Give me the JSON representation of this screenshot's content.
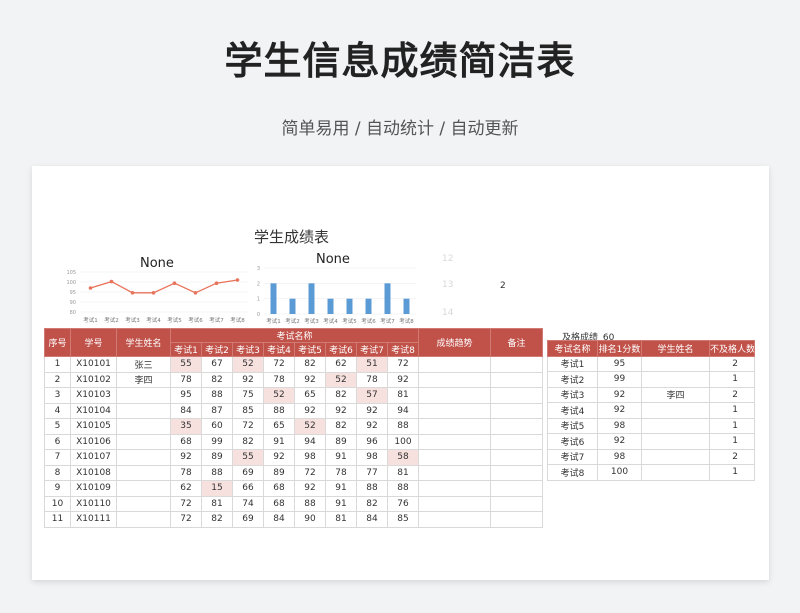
{
  "header": {
    "title": "学生信息成绩简洁表",
    "subtitle": "简单易用 / 自动统计 / 自动更新"
  },
  "sheet": {
    "title": "学生成绩表",
    "chart_label_value": "2",
    "pass_label": "及格成绩",
    "pass_value": "60",
    "faint_row_numbers": [
      "12",
      "13",
      "14"
    ]
  },
  "chart_data": [
    {
      "type": "line",
      "title": "None",
      "categories": [
        "考试1",
        "考试2",
        "考试3",
        "考试4",
        "考试5",
        "考试6",
        "考试7",
        "考试8"
      ],
      "values": [
        95,
        99,
        92,
        92,
        98,
        92,
        98,
        100
      ],
      "ylim": [
        80,
        105
      ],
      "yticks": [
        "80",
        "90",
        "95",
        "100",
        "105"
      ],
      "color": "#e8735a"
    },
    {
      "type": "bar",
      "title": "None",
      "categories": [
        "考试1",
        "考试2",
        "考试3",
        "考试4",
        "考试5",
        "考试6",
        "考试7",
        "考试8"
      ],
      "values": [
        2,
        1,
        2,
        1,
        1,
        1,
        2,
        1
      ],
      "ylim": [
        0,
        3
      ],
      "yticks": [
        "0",
        "1",
        "2",
        "3"
      ],
      "color": "#5b9bd5"
    }
  ],
  "main_table": {
    "headers": {
      "no": "序号",
      "id": "学号",
      "name": "学生姓名",
      "exam_group": "考试名称",
      "trend": "成绩趋势",
      "note": "备注"
    },
    "exams": [
      "考试1",
      "考试2",
      "考试3",
      "考试4",
      "考试5",
      "考试6",
      "考试7",
      "考试8"
    ],
    "rows": [
      {
        "no": "1",
        "id": "X10101",
        "name": "张三",
        "scores": [
          "55",
          "67",
          "52",
          "72",
          "82",
          "62",
          "51",
          "72"
        ]
      },
      {
        "no": "2",
        "id": "X10102",
        "name": "李四",
        "scores": [
          "78",
          "82",
          "92",
          "78",
          "92",
          "52",
          "78",
          "92"
        ]
      },
      {
        "no": "3",
        "id": "X10103",
        "name": "",
        "scores": [
          "95",
          "88",
          "75",
          "52",
          "65",
          "82",
          "57",
          "81"
        ]
      },
      {
        "no": "4",
        "id": "X10104",
        "name": "",
        "scores": [
          "84",
          "87",
          "85",
          "88",
          "92",
          "92",
          "92",
          "94"
        ]
      },
      {
        "no": "5",
        "id": "X10105",
        "name": "",
        "scores": [
          "35",
          "60",
          "72",
          "65",
          "52",
          "82",
          "92",
          "88"
        ]
      },
      {
        "no": "6",
        "id": "X10106",
        "name": "",
        "scores": [
          "68",
          "99",
          "82",
          "91",
          "94",
          "89",
          "96",
          "100"
        ]
      },
      {
        "no": "7",
        "id": "X10107",
        "name": "",
        "scores": [
          "92",
          "89",
          "55",
          "92",
          "98",
          "91",
          "98",
          "58"
        ]
      },
      {
        "no": "8",
        "id": "X10108",
        "name": "",
        "scores": [
          "78",
          "88",
          "69",
          "89",
          "72",
          "78",
          "77",
          "81"
        ]
      },
      {
        "no": "9",
        "id": "X10109",
        "name": "",
        "scores": [
          "62",
          "15",
          "66",
          "68",
          "92",
          "91",
          "88",
          "88"
        ]
      },
      {
        "no": "10",
        "id": "X10110",
        "name": "",
        "scores": [
          "72",
          "81",
          "74",
          "68",
          "88",
          "91",
          "82",
          "76"
        ]
      },
      {
        "no": "11",
        "id": "X10111",
        "name": "",
        "scores": [
          "72",
          "82",
          "69",
          "84",
          "90",
          "81",
          "84",
          "85"
        ]
      }
    ]
  },
  "summary_table": {
    "headers": {
      "exam": "考试名称",
      "top": "排名1分数",
      "name": "学生姓名",
      "fail": "不及格人数"
    },
    "rows": [
      {
        "exam": "考试1",
        "top": "95",
        "name": "",
        "fail": "2"
      },
      {
        "exam": "考试2",
        "top": "99",
        "name": "",
        "fail": "1"
      },
      {
        "exam": "考试3",
        "top": "92",
        "name": "李四",
        "fail": "2"
      },
      {
        "exam": "考试4",
        "top": "92",
        "name": "",
        "fail": "1"
      },
      {
        "exam": "考试5",
        "top": "98",
        "name": "",
        "fail": "1"
      },
      {
        "exam": "考试6",
        "top": "92",
        "name": "",
        "fail": "1"
      },
      {
        "exam": "考试7",
        "top": "98",
        "name": "",
        "fail": "2"
      },
      {
        "exam": "考试8",
        "top": "100",
        "name": "",
        "fail": "1"
      }
    ]
  }
}
